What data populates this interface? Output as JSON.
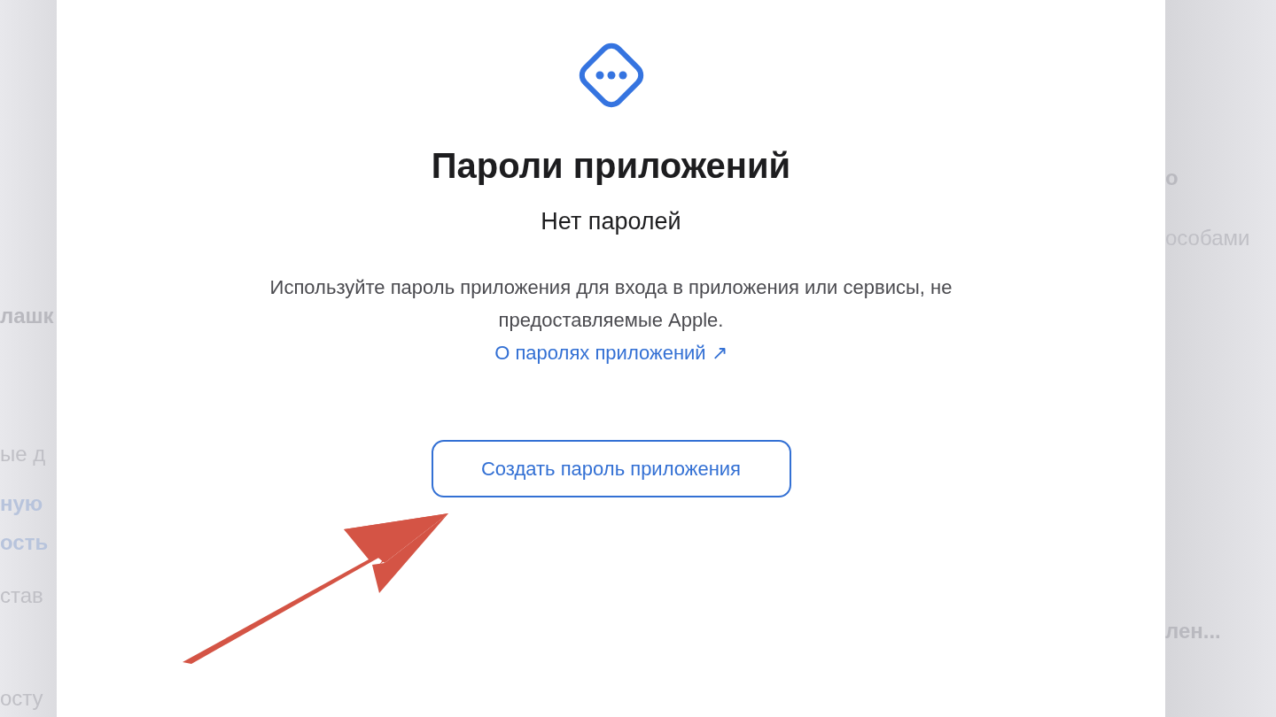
{
  "background_left": [
    {
      "text": "лашк",
      "kind": "heading"
    },
    {
      "text": "ые д",
      "kind": "muted"
    },
    {
      "text": "ную",
      "kind": "link"
    },
    {
      "text": "ость",
      "kind": "link"
    },
    {
      "text": "став",
      "kind": "muted"
    },
    {
      "text": "осту",
      "kind": "muted"
    }
  ],
  "background_right": [
    {
      "text": "о",
      "kind": "heading"
    },
    {
      "text": "особами",
      "kind": "muted"
    },
    {
      "text": "лен...",
      "kind": "heading"
    }
  ],
  "dialog": {
    "title": "Пароли приложений",
    "subtitle": "Нет паролей",
    "description": "Используйте пароль приложения для входа в приложения или сервисы, не предоставляемые Apple.",
    "link": "О паролях приложений ↗",
    "button": "Создать пароль приложения"
  }
}
